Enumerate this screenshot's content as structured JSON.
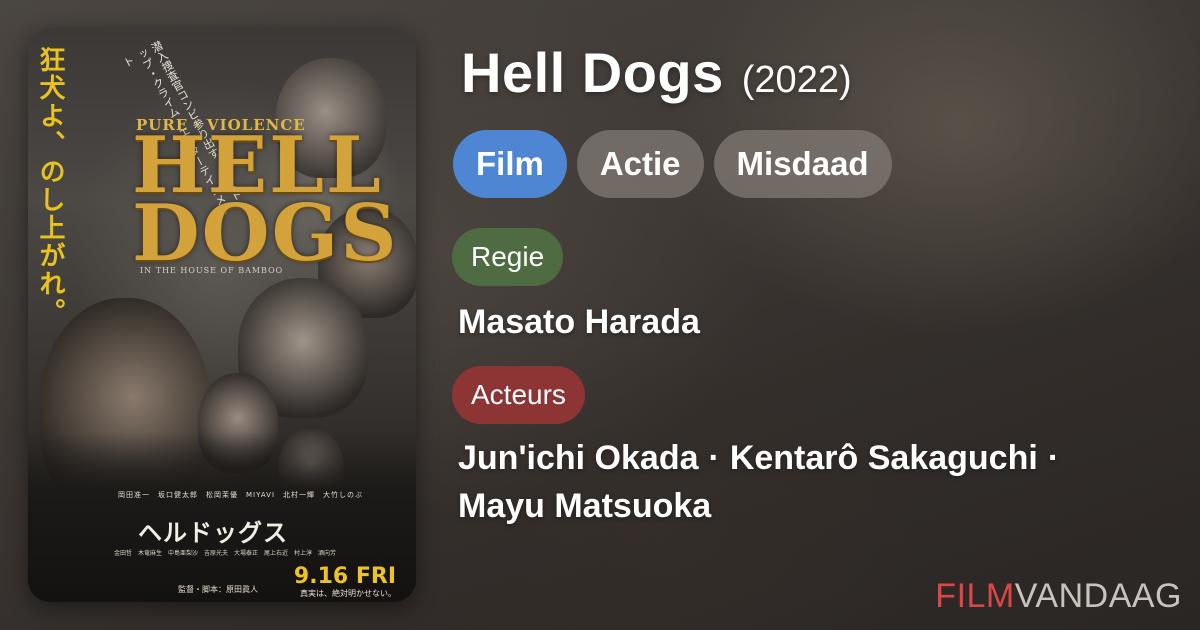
{
  "movie": {
    "title": "Hell Dogs",
    "year": "(2022)",
    "genres": [
      "Film",
      "Actie",
      "Misdaad"
    ]
  },
  "director": {
    "label": "Regie",
    "name": "Masato Harada"
  },
  "cast": {
    "label": "Acteurs",
    "actors": [
      "Jun'ichi Okada",
      "Kentarô Sakaguchi",
      "Mayu Matsuoka"
    ],
    "separator": "·"
  },
  "poster": {
    "side_text": "狂犬よ、のし上がれ。",
    "tagline": "潜入捜査官コンビ参り出す ノンストップ・クライム・エンターテインメント",
    "pure_violence": "PURE · VIOLENCE",
    "logo": "HELL DOGS",
    "subtitle": "IN THE HOUSE OF BAMBOO",
    "credits_top": "岡田准一　坂口健太郎　松岡茉優　MIYAVI　北村一輝　大竹しのぶ",
    "jp_title": "ヘルドッグス",
    "credits_bottom": "金田哲　木竜麻生　中島亜梨沙　吉原光夫　大場泰正　尾上右近　村上淳　酒向芳",
    "director_credit": "監督・脚本：原田眞人",
    "date": "9.16 FRI",
    "date_sub": "真実は、絶対明かせない。"
  },
  "brand": {
    "part1": "FILM",
    "part2": "VANDAAG"
  },
  "colors": {
    "film_chip": "#4f86d3",
    "regie_chip": "#4f6b42",
    "acteurs_chip": "#8d3434",
    "brand_red": "#d94747",
    "poster_logo": "#d3a23a"
  }
}
